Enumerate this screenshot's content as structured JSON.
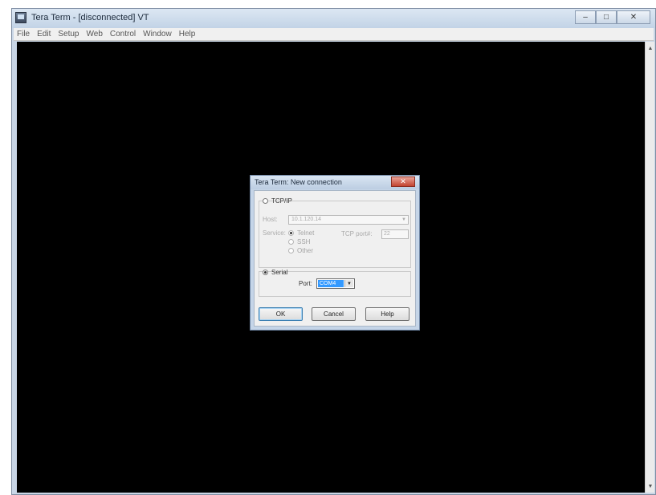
{
  "window": {
    "title": "Tera Term - [disconnected] VT",
    "controls": {
      "minimize": "–",
      "maximize": "□",
      "close": "✕"
    }
  },
  "menu": [
    "File",
    "Edit",
    "Setup",
    "Web",
    "Control",
    "Window",
    "Help"
  ],
  "dialog": {
    "title": "Tera Term: New connection",
    "close": "✕",
    "tcpip": {
      "radio_label": "TCP/IP",
      "selected": false,
      "host_label": "Host:",
      "host_value": "10.1.120.14",
      "service_label": "Service:",
      "services": [
        "Telnet",
        "SSH",
        "Other"
      ],
      "service_selected": "Telnet",
      "tcpport_label": "TCP port#:",
      "tcpport_value": "22"
    },
    "serial": {
      "radio_label": "Serial",
      "selected": true,
      "port_label": "Port:",
      "port_value": "COM4"
    },
    "buttons": {
      "ok": "OK",
      "cancel": "Cancel",
      "help": "Help"
    }
  },
  "scrollbar": {
    "up": "▲",
    "down": "▼"
  }
}
